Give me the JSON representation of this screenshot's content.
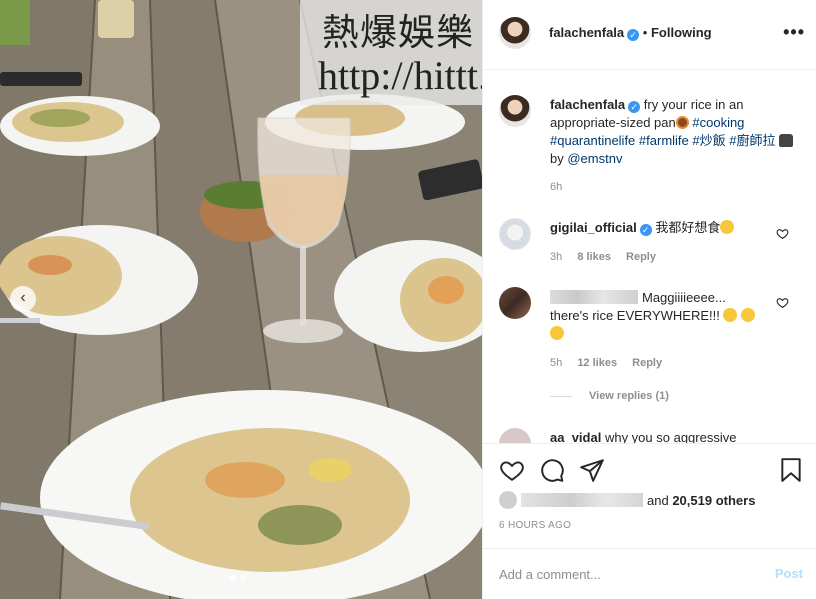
{
  "watermark": {
    "title": "熱爆娛樂",
    "url": "http://hittt.blogspot.com"
  },
  "header": {
    "username": "falachenfala",
    "separator": "•",
    "follow_status": "Following",
    "more_icon": "more-icon"
  },
  "caption": {
    "username": "falachenfala",
    "text_before": "fry your rice in an appropriate-sized pan",
    "hashtags": [
      "#cooking",
      "#quarantinelife",
      "#farmlife",
      "#炒飯",
      "#廚師拉"
    ],
    "by_text": "by",
    "mention": "@emstnv",
    "age": "6h"
  },
  "comments": [
    {
      "username": "gigilai_official",
      "text": "我都好想食",
      "age": "3h",
      "likes": "8 likes",
      "reply": "Reply"
    },
    {
      "username": "",
      "text": "Maggiiiieeee... there's rice EVERYWHERE!!!",
      "age": "5h",
      "likes": "12 likes",
      "reply": "Reply",
      "view_replies": "View replies (1)"
    },
    {
      "username": "aa_vidal",
      "text": "why you so aggressive"
    }
  ],
  "actions": {
    "icons": [
      "heart-icon",
      "comment-icon",
      "share-icon",
      "bookmark-icon"
    ]
  },
  "likes_line": {
    "and_text": "and",
    "count": "20,519 others"
  },
  "timestamp": "6 HOURS AGO",
  "add_comment": {
    "placeholder": "Add a comment...",
    "post_label": "Post"
  },
  "colors": {
    "link": "#00376b",
    "verified": "#3897f0",
    "muted": "#8e8e8e",
    "post_disabled": "#b2dffc"
  }
}
